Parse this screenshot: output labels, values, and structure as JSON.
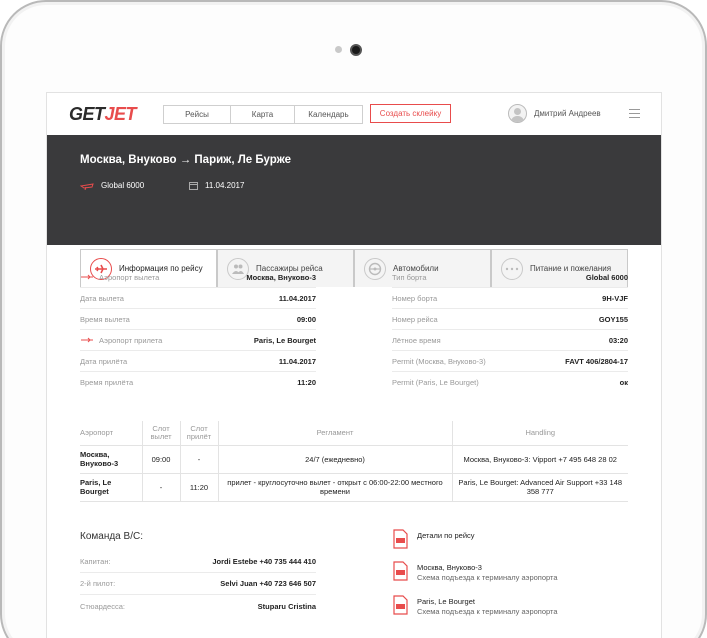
{
  "nav": {
    "logo_get": "GET",
    "logo_jet": "JET",
    "tabs": [
      "Рейсы",
      "Карта",
      "Календарь"
    ],
    "create_button": "Создать склейку",
    "user_name": "Дмитрий Андреев"
  },
  "flight": {
    "route": "Москва, Внуково → Париж, Ле Бурже",
    "aircraft": "Global 6000",
    "date": "11.04.2017"
  },
  "tabs": [
    {
      "label": "Информация по рейсу",
      "icon": "plane-icon",
      "active": true
    },
    {
      "label": "Пассажиры рейса",
      "icon": "passengers-icon",
      "active": false
    },
    {
      "label": "Автомобили",
      "icon": "steering-wheel-icon",
      "active": false
    },
    {
      "label": "Питание и пожелания",
      "icon": "more-icon",
      "active": false
    }
  ],
  "info_left": [
    {
      "label": "Аэропорт вылета",
      "value": "Москва, Внуково-3"
    },
    {
      "label": "Дата вылета",
      "value": "11.04.2017"
    },
    {
      "label": "Время вылета",
      "value": "09:00"
    },
    {
      "label": "Аэропорт прилета",
      "value": "Paris, Le Bourget"
    },
    {
      "label": "Дата прилёта",
      "value": "11.04.2017"
    },
    {
      "label": "Время прилёта",
      "value": "11:20"
    }
  ],
  "info_right": [
    {
      "label": "Тип борта",
      "value": "Global 6000"
    },
    {
      "label": "Номер борта",
      "value": "9H-VJF"
    },
    {
      "label": "Номер рейса",
      "value": "GOY155"
    },
    {
      "label": "Лётное время",
      "value": "03:20"
    },
    {
      "label": "Permit (Москва, Внуково-3)",
      "value": "FAVT 406/2804-17"
    },
    {
      "label": "Permit (Paris, Le Bourget)",
      "value": "ок"
    }
  ],
  "slots": {
    "headers": {
      "airport": "Аэропорт",
      "slot_dep": "Слот вылет",
      "slot_arr": "Слот прилёт",
      "regulation": "Регламент",
      "handling": "Handling"
    },
    "rows": [
      {
        "airport": "Москва, Внуково-3",
        "slot_dep": "09:00",
        "slot_arr": "-",
        "regulation": "24/7 (ежедневно)",
        "handling": "Москва, Внуково-3: Vipport +7 495 648 28 02"
      },
      {
        "airport": "Paris, Le Bourget",
        "slot_dep": "-",
        "slot_arr": "11:20",
        "regulation": "прилет - круглосуточно вылет - открыт с 06:00-22:00 местного времени",
        "handling": "Paris, Le Bourget: Advanced Air Support +33 148 358 777"
      }
    ]
  },
  "crew": {
    "title": "Команда В/С:",
    "members": [
      {
        "label": "Капитан:",
        "value": "Jordi Estebe +40 735 444 410"
      },
      {
        "label": "2-й пилот:",
        "value": "Selvi Juan +40 723 646 507"
      },
      {
        "label": "Стюардесса:",
        "value": "Stuparu Cristina"
      }
    ]
  },
  "docs": [
    {
      "title": "Детали по рейсу",
      "subtitle": ""
    },
    {
      "title": "Москва, Внуково-3",
      "subtitle": "Схема подъезда к терминалу аэропорта"
    },
    {
      "title": "Paris, Le Bourget",
      "subtitle": "Схема подъезда к терминалу аэропорта"
    }
  ],
  "colors": {
    "accent": "#e84c4c",
    "header_bg": "#3a3a3c"
  }
}
